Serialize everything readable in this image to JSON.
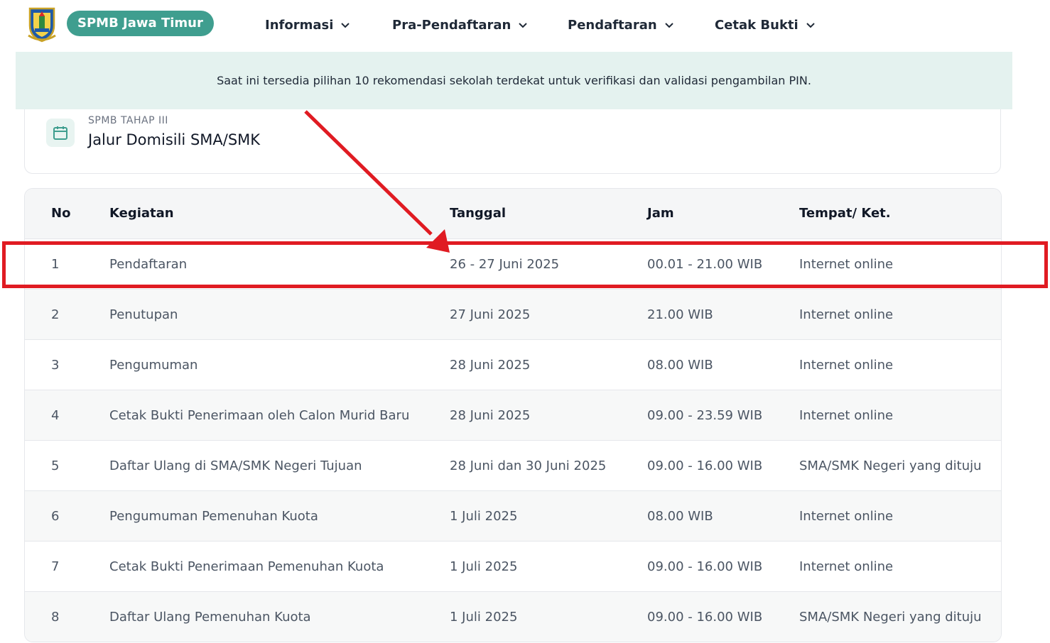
{
  "header": {
    "brand": "SPMB Jawa Timur",
    "nav": [
      {
        "label": "Informasi",
        "icon": "chevron-down-icon"
      },
      {
        "label": "Pra-Pendaftaran",
        "icon": "chevron-down-icon"
      },
      {
        "label": "Pendaftaran",
        "icon": "chevron-down-icon"
      },
      {
        "label": "Cetak Bukti",
        "icon": "chevron-down-icon"
      }
    ]
  },
  "banner": {
    "text": "Saat ini tersedia pilihan 10 rekomendasi sekolah terdekat untuk verifikasi dan validasi pengambilan PIN."
  },
  "stage": {
    "icon": "calendar-icon",
    "subtitle": "SPMB TAHAP III",
    "title": "Jalur Domisili SMA/SMK"
  },
  "table": {
    "headers": [
      "No",
      "Kegiatan",
      "Tanggal",
      "Jam",
      "Tempat/ Ket."
    ],
    "rows": [
      [
        "1",
        "Pendaftaran",
        "26 - 27 Juni 2025",
        "00.01 - 21.00 WIB",
        "Internet online"
      ],
      [
        "2",
        "Penutupan",
        "27 Juni 2025",
        "21.00 WIB",
        "Internet online"
      ],
      [
        "3",
        "Pengumuman",
        "28 Juni 2025",
        "08.00 WIB",
        "Internet online"
      ],
      [
        "4",
        "Cetak Bukti Penerimaan oleh Calon Murid Baru",
        "28 Juni 2025",
        "09.00 - 23.59 WIB",
        "Internet online"
      ],
      [
        "5",
        "Daftar Ulang di SMA/SMK Negeri Tujuan",
        "28 Juni dan 30 Juni 2025",
        "09.00 - 16.00 WIB",
        "SMA/SMK Negeri yang dituju"
      ],
      [
        "6",
        "Pengumuman Pemenuhan Kuota",
        "1 Juli 2025",
        "08.00 WIB",
        "Internet online"
      ],
      [
        "7",
        "Cetak Bukti Penerimaan Pemenuhan Kuota",
        "1 Juli 2025",
        "09.00 - 16.00 WIB",
        "Internet online"
      ],
      [
        "8",
        "Daftar Ulang Pemenuhan Kuota",
        "1 Juli 2025",
        "09.00 - 16.00 WIB",
        "SMA/SMK Negeri yang dituju"
      ]
    ]
  },
  "colors": {
    "brand": "#3f9e8f",
    "banner_bg": "#e4f2ef",
    "annotation": "#e01b22"
  }
}
